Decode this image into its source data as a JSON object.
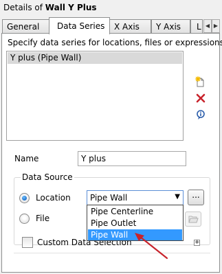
{
  "header": {
    "prefix": "Details of ",
    "object_name": "Wall Y Plus"
  },
  "tabs": [
    {
      "label": "General"
    },
    {
      "label": "Data Series"
    },
    {
      "label": "X Axis"
    },
    {
      "label": "Y Axis"
    },
    {
      "label": "L"
    }
  ],
  "data_series": {
    "instruction": "Specify data series for locations, files or expressions",
    "items": [
      {
        "label": "Y plus (Pipe Wall)"
      }
    ],
    "name_label": "Name",
    "name_value": "Y plus",
    "data_source": {
      "title": "Data Source",
      "location_label": "Location",
      "location_value": "Pipe Wall",
      "location_options": [
        "Pipe Centerline",
        "Pipe Outlet",
        "Pipe Wall"
      ],
      "file_label": "File",
      "browse_label": "..."
    },
    "custom_data_selection_label": "Custom Data Selection"
  },
  "colors": {
    "selection": "#3399ff",
    "arrow": "#c8232c"
  }
}
